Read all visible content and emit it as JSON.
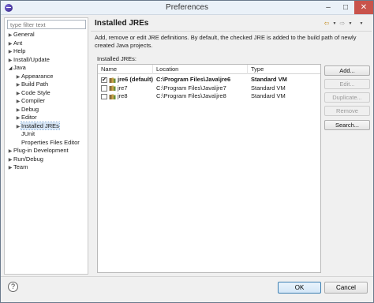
{
  "window": {
    "title": "Preferences",
    "controls": {
      "minimize": "–",
      "maximize": "□",
      "close": "✕"
    }
  },
  "sidebar": {
    "filter_placeholder": "type filter text",
    "items": [
      {
        "label": "General",
        "level": 0,
        "arrow": "▶",
        "expanded": false
      },
      {
        "label": "Ant",
        "level": 0,
        "arrow": "▶",
        "expanded": false
      },
      {
        "label": "Help",
        "level": 0,
        "arrow": "▶",
        "expanded": false
      },
      {
        "label": "Install/Update",
        "level": 0,
        "arrow": "▶",
        "expanded": false
      },
      {
        "label": "Java",
        "level": 0,
        "arrow": "◢",
        "expanded": true
      },
      {
        "label": "Appearance",
        "level": 1,
        "arrow": "▶",
        "expanded": false
      },
      {
        "label": "Build Path",
        "level": 1,
        "arrow": "▶",
        "expanded": false
      },
      {
        "label": "Code Style",
        "level": 1,
        "arrow": "▶",
        "expanded": false
      },
      {
        "label": "Compiler",
        "level": 1,
        "arrow": "▶",
        "expanded": false
      },
      {
        "label": "Debug",
        "level": 1,
        "arrow": "▶",
        "expanded": false
      },
      {
        "label": "Editor",
        "level": 1,
        "arrow": "▶",
        "expanded": false
      },
      {
        "label": "Installed JREs",
        "level": 1,
        "arrow": "▶",
        "expanded": false,
        "selected": true
      },
      {
        "label": "JUnit",
        "level": 1,
        "arrow": "",
        "expanded": false
      },
      {
        "label": "Properties Files Editor",
        "level": 1,
        "arrow": "",
        "expanded": false
      },
      {
        "label": "Plug-in Development",
        "level": 0,
        "arrow": "▶",
        "expanded": false
      },
      {
        "label": "Run/Debug",
        "level": 0,
        "arrow": "▶",
        "expanded": false
      },
      {
        "label": "Team",
        "level": 0,
        "arrow": "▶",
        "expanded": false
      }
    ]
  },
  "main": {
    "title": "Installed JREs",
    "nav": {
      "back_icon": "⇦",
      "forward_icon": "⇨",
      "dropdown_icon": "▼"
    },
    "description": "Add, remove or edit JRE definitions. By default, the checked JRE is added to the build path of newly created Java projects.",
    "table_label": "Installed JREs:",
    "columns": [
      "Name",
      "Location",
      "Type"
    ],
    "rows": [
      {
        "checked": true,
        "name": "jre6 (default)",
        "location": "C:\\Program Files\\Java\\jre6",
        "type": "Standard VM",
        "bold": true
      },
      {
        "checked": false,
        "name": "jre7",
        "location": "C:\\Program Files\\Java\\jre7",
        "type": "Standard VM",
        "bold": false
      },
      {
        "checked": false,
        "name": "jre8",
        "location": "C:\\Program Files\\Java\\jre8",
        "type": "Standard VM",
        "bold": false
      }
    ],
    "buttons": [
      {
        "label": "Add...",
        "enabled": true
      },
      {
        "label": "Edit...",
        "enabled": false
      },
      {
        "label": "Duplicate...",
        "enabled": false
      },
      {
        "label": "Remove",
        "enabled": false
      },
      {
        "label": "Search...",
        "enabled": true
      }
    ]
  },
  "footer": {
    "help_icon": "?",
    "ok_label": "OK",
    "cancel_label": "Cancel"
  },
  "colors": {
    "selection": "#d7e6f6",
    "close_button": "#c9534b",
    "ok_border": "#3c7fb1"
  }
}
